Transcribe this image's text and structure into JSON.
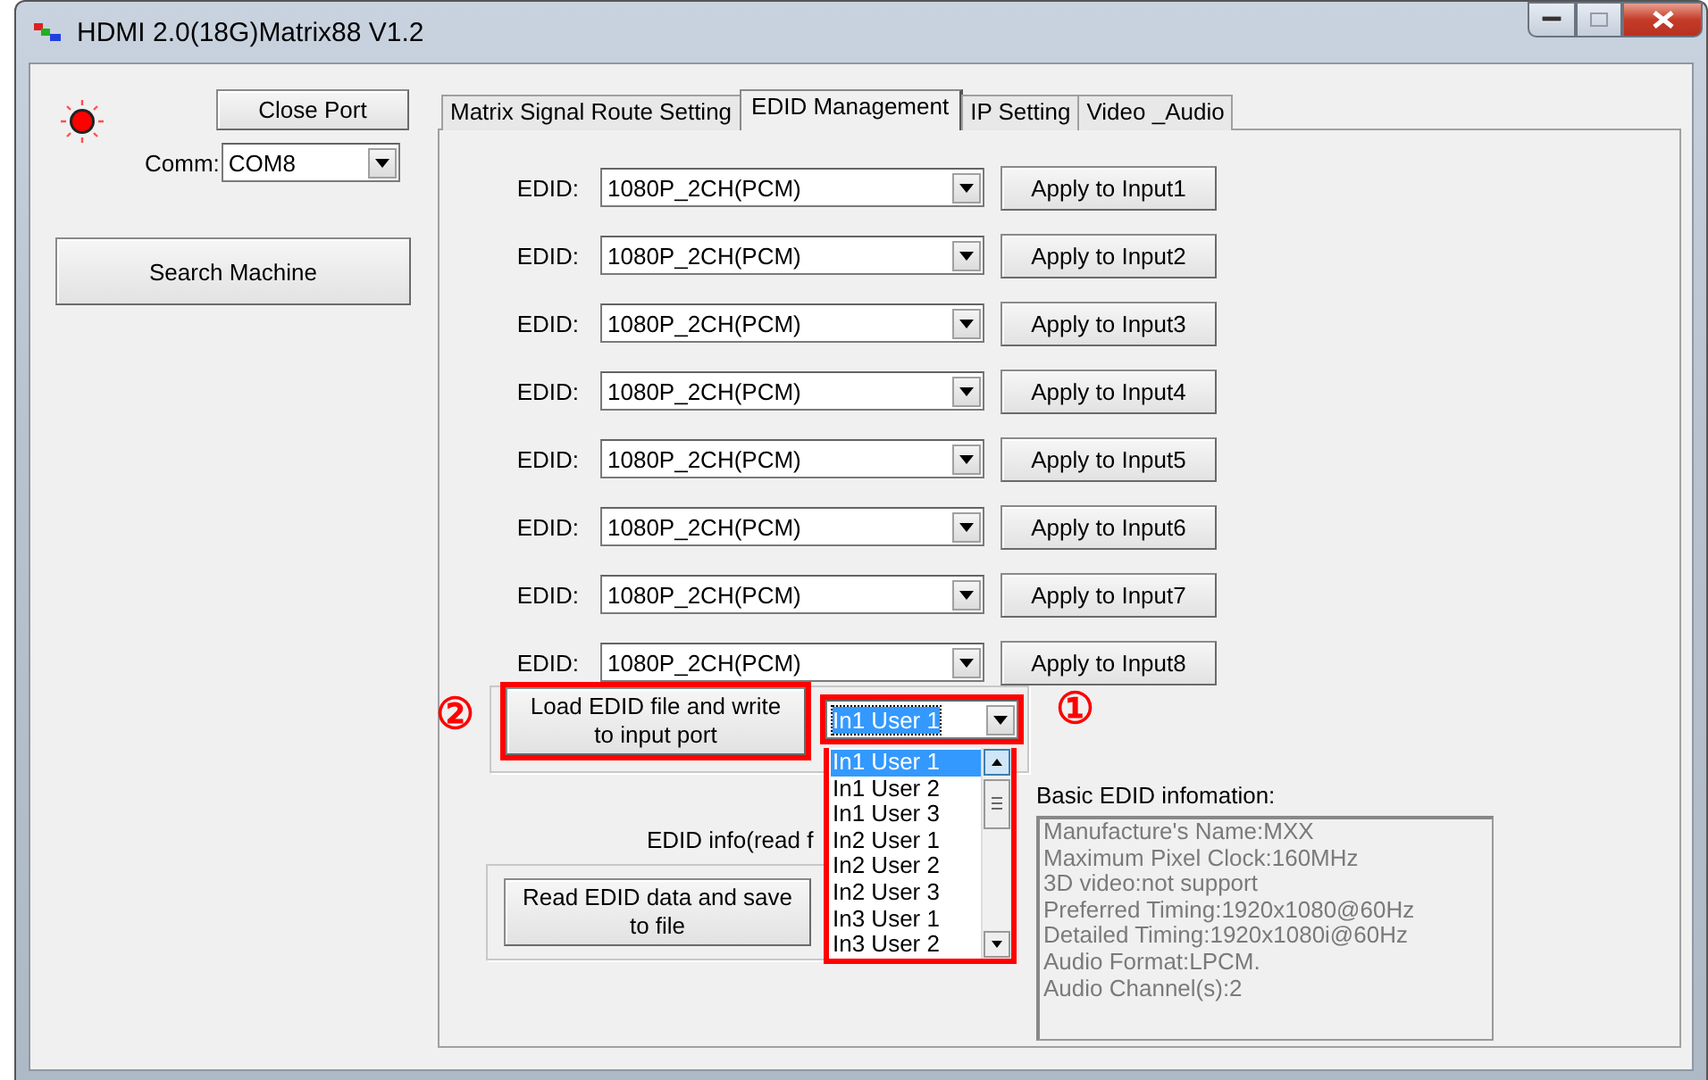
{
  "window": {
    "title": "HDMI 2.0(18G)Matrix88 V1.2"
  },
  "connection": {
    "connected": true,
    "close_button": "Close Port",
    "comm_label": "Comm:",
    "comm_value": "COM8",
    "search_button": "Search Machine"
  },
  "tabs": [
    {
      "label": "Matrix Signal Route Setting",
      "selected": false
    },
    {
      "label": "EDID Management",
      "selected": true
    },
    {
      "label": "IP Setting",
      "selected": false
    },
    {
      "label": "Video _Audio",
      "selected": false
    }
  ],
  "edid_rows": [
    {
      "label": "EDID:",
      "value": "1080P_2CH(PCM)",
      "button": "Apply to Input1"
    },
    {
      "label": "EDID:",
      "value": "1080P_2CH(PCM)",
      "button": "Apply to Input2"
    },
    {
      "label": "EDID:",
      "value": "1080P_2CH(PCM)",
      "button": "Apply to Input3"
    },
    {
      "label": "EDID:",
      "value": "1080P_2CH(PCM)",
      "button": "Apply to Input4"
    },
    {
      "label": "EDID:",
      "value": "1080P_2CH(PCM)",
      "button": "Apply to Input5"
    },
    {
      "label": "EDID:",
      "value": "1080P_2CH(PCM)",
      "button": "Apply to Input6"
    },
    {
      "label": "EDID:",
      "value": "1080P_2CH(PCM)",
      "button": "Apply to Input7"
    },
    {
      "label": "EDID:",
      "value": "1080P_2CH(PCM)",
      "button": "Apply to Input8"
    }
  ],
  "load": {
    "button": "Load EDID file and write to input port",
    "highlighted": true,
    "marker": "②"
  },
  "user_select": {
    "value": "In1 User 1",
    "highlighted": true,
    "marker": "①",
    "expanded": true,
    "options": [
      {
        "label": "In1 User 1",
        "selected": true
      },
      {
        "label": "In1 User 2",
        "selected": false
      },
      {
        "label": "In1 User 3",
        "selected": false
      },
      {
        "label": "In2 User 1",
        "selected": false
      },
      {
        "label": "In2 User 2",
        "selected": false
      },
      {
        "label": "In2 User 3",
        "selected": false
      },
      {
        "label": "In3 User 1",
        "selected": false
      },
      {
        "label": "In3 User 2",
        "selected": false
      }
    ]
  },
  "edid_info_label": "EDID info(read f",
  "read_button": "Read EDID data and save to file",
  "basic_info": {
    "label": "Basic EDID infomation:",
    "lines": [
      "Manufacture's Name:MXX",
      "Maximum Pixel Clock:160MHz",
      "3D video:not support",
      "Preferred Timing:1920x1080@60Hz",
      "Detailed Timing:1920x1080i@60Hz",
      "Audio Format:LPCM.",
      "Audio Channel(s):2"
    ]
  }
}
